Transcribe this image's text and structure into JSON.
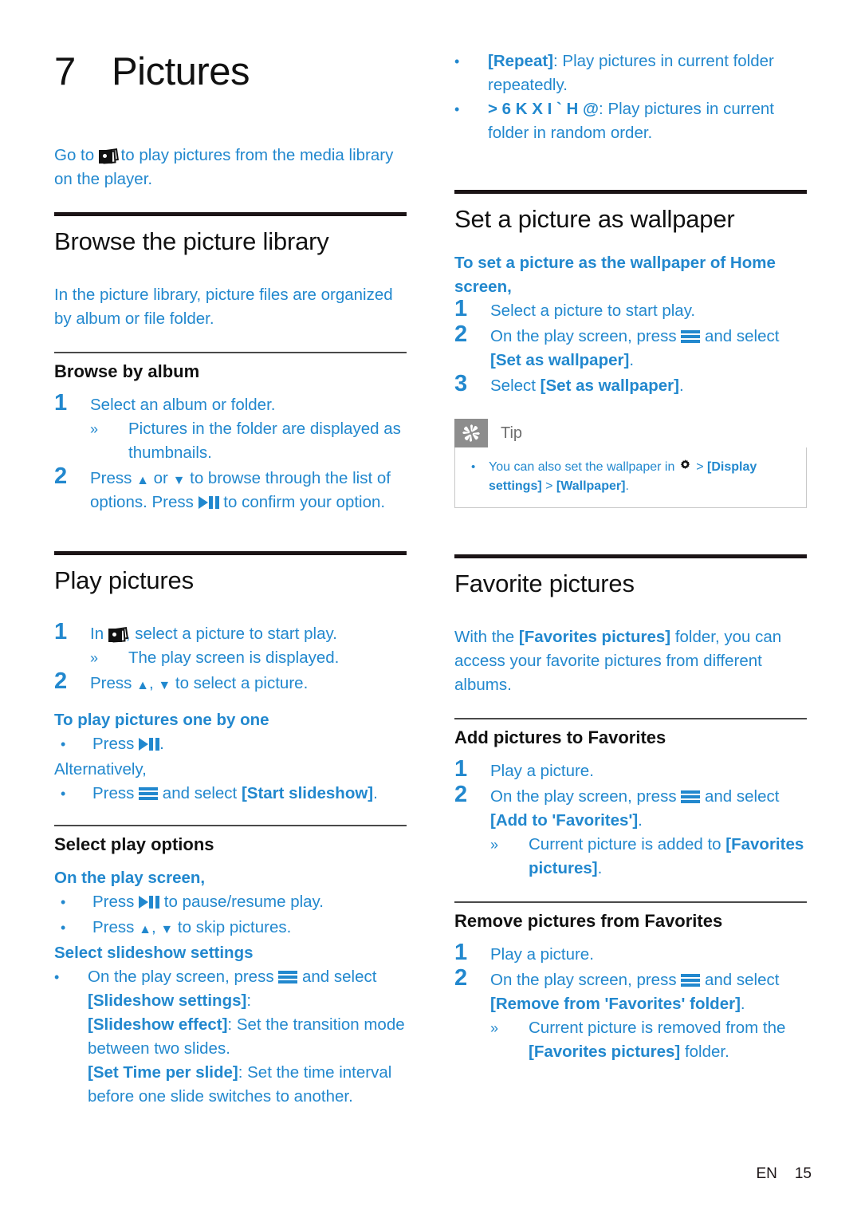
{
  "document": {
    "chapter_number": "7",
    "chapter_title": "Pictures",
    "footer": {
      "language": "EN",
      "page_number": "15"
    }
  },
  "colors": {
    "accent_blue": "#2288ce",
    "heading_black": "#111111",
    "rule_black": "#1b1416",
    "tip_gray": "#8d8d8d",
    "tip_label_gray": "#6f6f6f",
    "tip_border": "#c8c8c8"
  },
  "left_column": {
    "intro": {
      "before_icon": "Go to ",
      "icon": "pictures-icon",
      "after_icon": " to play pictures from the media library on the player."
    },
    "browse_library": {
      "title": "Browse the picture library",
      "intro": "In the picture library, picture files are organized by album or file folder.",
      "browse_by_album": {
        "title": "Browse by album",
        "step1": "Select an album or folder.",
        "step1_result": "Pictures in the folder are displayed as thumbnails.",
        "step2_a": "Press ",
        "step2_b": " or ",
        "step2_c": " to browse through the list of options. Press ",
        "step2_d": " to confirm your option."
      }
    },
    "play_pictures": {
      "title": "Play pictures",
      "step1_before": "In ",
      "step1_after": ", select a picture to start play.",
      "step1_result": "The play screen is displayed.",
      "step2_a": "Press ",
      "step2_b": ", ",
      "step2_c": " to select a picture.",
      "one_by_one_heading": "To play pictures one by one",
      "one_by_one_bullet_before": "Press ",
      "one_by_one_bullet_after": ".",
      "alternatively": "Alternatively,",
      "alt_bullet_before": "Press ",
      "alt_bullet_mid": " and select ",
      "alt_bullet_bold": "[Start slideshow]",
      "alt_bullet_after": "."
    },
    "select_play_options": {
      "title": "Select play options",
      "on_play_screen": "On the play screen,",
      "bullet1_before": "Press ",
      "bullet1_after": " to pause/resume play.",
      "bullet2_before": "Press ",
      "bullet2_mid": ", ",
      "bullet2_after": " to skip pictures.",
      "slideshow_settings_heading": "Select slideshow settings",
      "ss_bullet_before": "On the play screen, press ",
      "ss_bullet_mid": " and select ",
      "ss_bullet_bold": "[Slideshow settings]",
      "ss_bullet_after": ":",
      "effect_bold": "[Slideshow effect]",
      "effect_text": ": Set the transition mode between two slides.",
      "time_bold": "[Set Time per slide]",
      "time_text": ": Set the time interval before one slide switches to another."
    }
  },
  "right_column": {
    "continued_options": {
      "repeat_bold": "[Repeat]",
      "repeat_text": ": Play pictures in current folder repeatedly.",
      "shuffle_bold": "> 6 K X I ` H @",
      "shuffle_text": ": Play pictures in current folder in random order."
    },
    "set_wallpaper": {
      "title": "Set a picture as wallpaper",
      "lead": "To set a picture as the wallpaper of Home screen,",
      "step1": "Select a picture to start play.",
      "step2_before": "On the play screen, press ",
      "step2_mid": " and select ",
      "step2_bold": "[Set as wallpaper]",
      "step2_after": ".",
      "step3_before": "Select ",
      "step3_bold": "[Set as wallpaper]",
      "step3_after": ".",
      "tip": {
        "label": "Tip",
        "icon": "asterisk-icon",
        "bullet_before": "You can also set the wallpaper in ",
        "gear_icon": "gear-icon",
        "bullet_mid": " > ",
        "bullet_bold1": "[Display settings]",
        "bullet_sep": " > ",
        "bullet_bold2": "[Wallpaper]",
        "bullet_after": "."
      }
    },
    "favorite_pictures": {
      "title": "Favorite pictures",
      "intro_before": "With the ",
      "intro_bold": "[Favorites pictures]",
      "intro_after": " folder, you can access your favorite pictures from different albums.",
      "add": {
        "title": "Add pictures to Favorites",
        "step1": "Play a picture.",
        "step2_before": "On the play screen, press ",
        "step2_mid": " and select ",
        "step2_bold": "[Add to 'Favorites']",
        "step2_after": ".",
        "result_before": "Current picture is added to ",
        "result_bold": "[Favorites pictures]",
        "result_after": "."
      },
      "remove": {
        "title": "Remove pictures from Favorites",
        "step1": "Play a picture.",
        "step2_before": "On the play screen, press ",
        "step2_mid": " and select ",
        "step2_bold": "[Remove from 'Favorites' folder]",
        "step2_after": ".",
        "result_before": "Current picture is removed from the ",
        "result_bold": "[Favorites pictures]",
        "result_after": " folder."
      }
    }
  }
}
